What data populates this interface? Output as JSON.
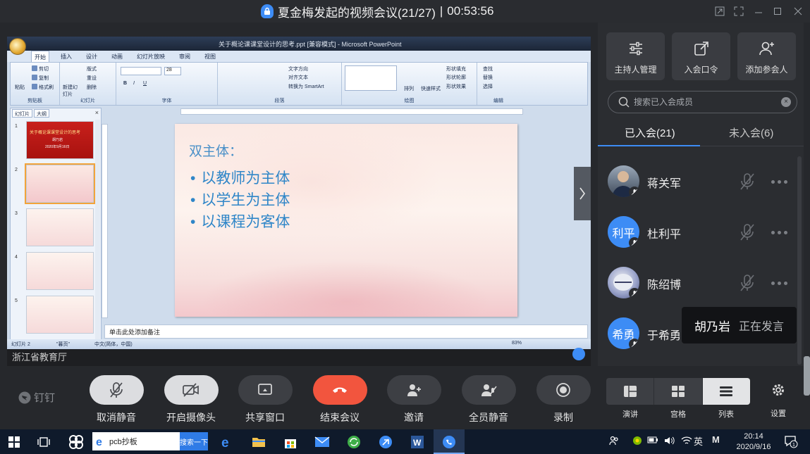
{
  "window": {
    "title": "夏金梅发起的视频会议(21/27)",
    "separator": "|",
    "duration": "00:53:56"
  },
  "share": {
    "owner_label": "浙江省教育厅",
    "document_title": "关于概论课课堂设计的思考.ppt [兼容模式] - Microsoft PowerPoint",
    "ribbon_tabs": [
      "开始",
      "插入",
      "设计",
      "动画",
      "幻灯片放映",
      "审阅",
      "视图"
    ],
    "ribbon_groups": [
      "剪贴板",
      "幻灯片",
      "字体",
      "段落",
      "绘图",
      "编辑"
    ],
    "ribbon_buttons": {
      "paste": "粘贴",
      "cut": "剪切",
      "copy": "复制",
      "format_painter": "格式刷",
      "new_slide": "新建幻灯片",
      "layout": "版式",
      "reset": "重设",
      "delete": "删除",
      "font_size": "28",
      "text_direction": "文字方向",
      "align_text": "对齐文本",
      "smartart": "转换为 SmartArt",
      "arrange": "排列",
      "quick_styles": "快速样式",
      "shape_fill": "形状填充",
      "shape_outline": "形状轮廓",
      "shape_effects": "形状效果",
      "find": "查找",
      "replace": "替换",
      "select": "选择"
    },
    "left_tabs": [
      "幻灯片",
      "大纲"
    ],
    "thumb_numbers": [
      "1",
      "2",
      "3",
      "4",
      "5"
    ],
    "thumb1_title": "关于概论课课堂设计的思考",
    "thumb1_author": "胡乃岩",
    "thumb1_date": "2020年9月16日",
    "slide": {
      "title": "双主体：",
      "bullets": [
        "以教师为主体",
        "以学生为主体",
        "以课程为客体"
      ]
    },
    "notes_placeholder": "单击此处添加备注",
    "status": {
      "theme": "\"暮页\"",
      "language": "中文(简体，中国)",
      "zoom": "83%",
      "slide_counter": "幻灯片 2"
    }
  },
  "panel": {
    "tools": [
      {
        "label": "主持人管理",
        "icon": "sliders-icon"
      },
      {
        "label": "入会口令",
        "icon": "share-link-icon"
      },
      {
        "label": "添加参会人",
        "icon": "add-user-icon"
      }
    ],
    "search_placeholder": "搜索已入会成员",
    "tab_joined": "已入会(21)",
    "tab_not_joined": "未入会(6)",
    "members": [
      {
        "name": "蒋关军",
        "avatar_text": "",
        "muted": true
      },
      {
        "name": "杜利平",
        "avatar_text": "利平",
        "muted": true
      },
      {
        "name": "陈绍博",
        "avatar_text": "",
        "muted": true
      },
      {
        "name": "于希勇",
        "avatar_text": "希勇",
        "muted": true
      }
    ],
    "speaking": {
      "name": "胡乃岩",
      "status": "正在发言"
    }
  },
  "toolbar": {
    "brand": "钉钉",
    "buttons": [
      {
        "label": "取消静音",
        "icon": "mic-muted-icon"
      },
      {
        "label": "开启摄像头",
        "icon": "camera-off-icon"
      },
      {
        "label": "共享窗口",
        "icon": "share-screen-icon"
      },
      {
        "label": "结束会议",
        "icon": "hangup-icon"
      },
      {
        "label": "邀请",
        "icon": "invite-icon"
      },
      {
        "label": "全员静音",
        "icon": "mute-all-icon"
      },
      {
        "label": "录制",
        "icon": "record-icon"
      }
    ],
    "layouts": [
      "演讲",
      "宫格",
      "列表"
    ],
    "settings": "设置"
  },
  "taskbar": {
    "search_value": "pcb抄板",
    "search_button": "搜索一下",
    "ime": "英",
    "ime2": "M",
    "time": "20:14",
    "date": "2020/9/16",
    "notification_count": "1"
  },
  "colors": {
    "accent": "#3d8cf5",
    "end_call": "#f2553e",
    "panel_bg": "#2b2d31",
    "slide_text": "#2f86c8"
  }
}
